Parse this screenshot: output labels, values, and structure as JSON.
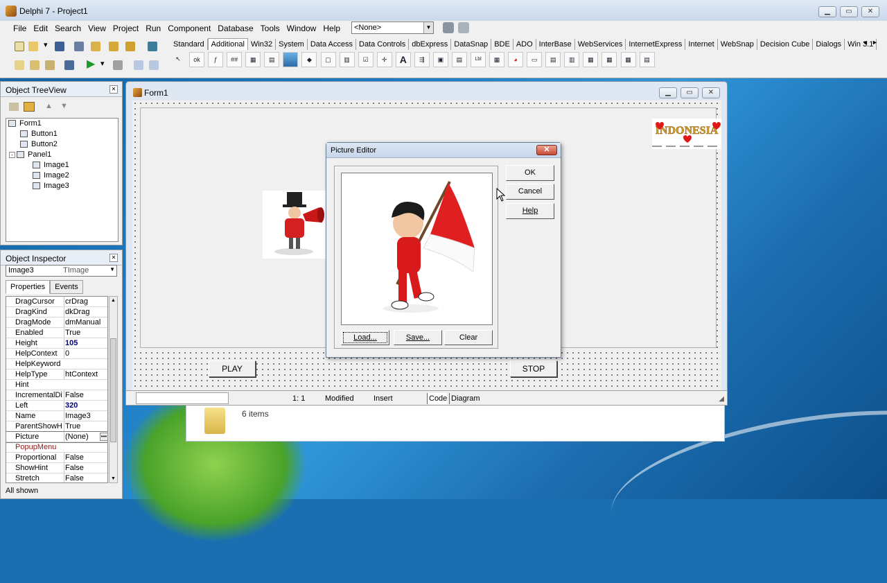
{
  "ide": {
    "title": "Delphi 7 - Project1",
    "menu": [
      "File",
      "Edit",
      "Search",
      "View",
      "Project",
      "Run",
      "Component",
      "Database",
      "Tools",
      "Window",
      "Help"
    ],
    "desktop_combo": "<None>",
    "palette_tabs": [
      "Standard",
      "Additional",
      "Win32",
      "System",
      "Data Access",
      "Data Controls",
      "dbExpress",
      "DataSnap",
      "BDE",
      "ADO",
      "InterBase",
      "WebServices",
      "InternetExpress",
      "Internet",
      "WebSnap",
      "Decision Cube",
      "Dialogs",
      "Win 3.1"
    ],
    "active_palette_tab": "Additional",
    "palette_scroll_left": "◄",
    "palette_scroll_right": "►"
  },
  "object_treeview": {
    "title": "Object TreeView",
    "nodes": [
      {
        "label": "Form1"
      },
      {
        "label": "Button1"
      },
      {
        "label": "Button2"
      },
      {
        "label": "Panel1"
      },
      {
        "label": "Image1"
      },
      {
        "label": "Image2"
      },
      {
        "label": "Image3"
      }
    ]
  },
  "object_inspector": {
    "title": "Object Inspector",
    "selected_name": "Image3",
    "selected_type": "TImage",
    "tabs": [
      "Properties",
      "Events"
    ],
    "properties": [
      {
        "name": "DragCursor",
        "value": "crDrag"
      },
      {
        "name": "DragKind",
        "value": "dkDrag"
      },
      {
        "name": "DragMode",
        "value": "dmManual"
      },
      {
        "name": "Enabled",
        "value": "True"
      },
      {
        "name": "Height",
        "value": "105"
      },
      {
        "name": "HelpContext",
        "value": "0"
      },
      {
        "name": "HelpKeyword",
        "value": ""
      },
      {
        "name": "HelpType",
        "value": "htContext"
      },
      {
        "name": "Hint",
        "value": ""
      },
      {
        "name": "IncrementalDis",
        "value": "False"
      },
      {
        "name": "Left",
        "value": "320"
      },
      {
        "name": "Name",
        "value": "Image3"
      },
      {
        "name": "ParentShowHir",
        "value": "True"
      },
      {
        "name": "Picture",
        "value": "(None)"
      },
      {
        "name": "PopupMenu",
        "value": ""
      },
      {
        "name": "Proportional",
        "value": "False"
      },
      {
        "name": "ShowHint",
        "value": "False"
      },
      {
        "name": "Stretch",
        "value": "False"
      }
    ],
    "status": "All shown"
  },
  "form": {
    "title": "Form1",
    "play_label": "PLAY",
    "stop_label": "STOP",
    "banner_text": "INDONESIA"
  },
  "editor_status": {
    "position": "1:   1",
    "modified": "Modified",
    "mode": "Insert",
    "tab_code": "Code",
    "tab_diagram": "Diagram"
  },
  "explorer": {
    "items": "6 items"
  },
  "picture_editor": {
    "title": "Picture Editor",
    "ok": "OK",
    "cancel": "Cancel",
    "help": "Help",
    "load": "Load...",
    "save": "Save...",
    "clear": "Clear"
  },
  "colors": {
    "flag_red": "#e02020",
    "title_blue": "#c6d6ea"
  }
}
